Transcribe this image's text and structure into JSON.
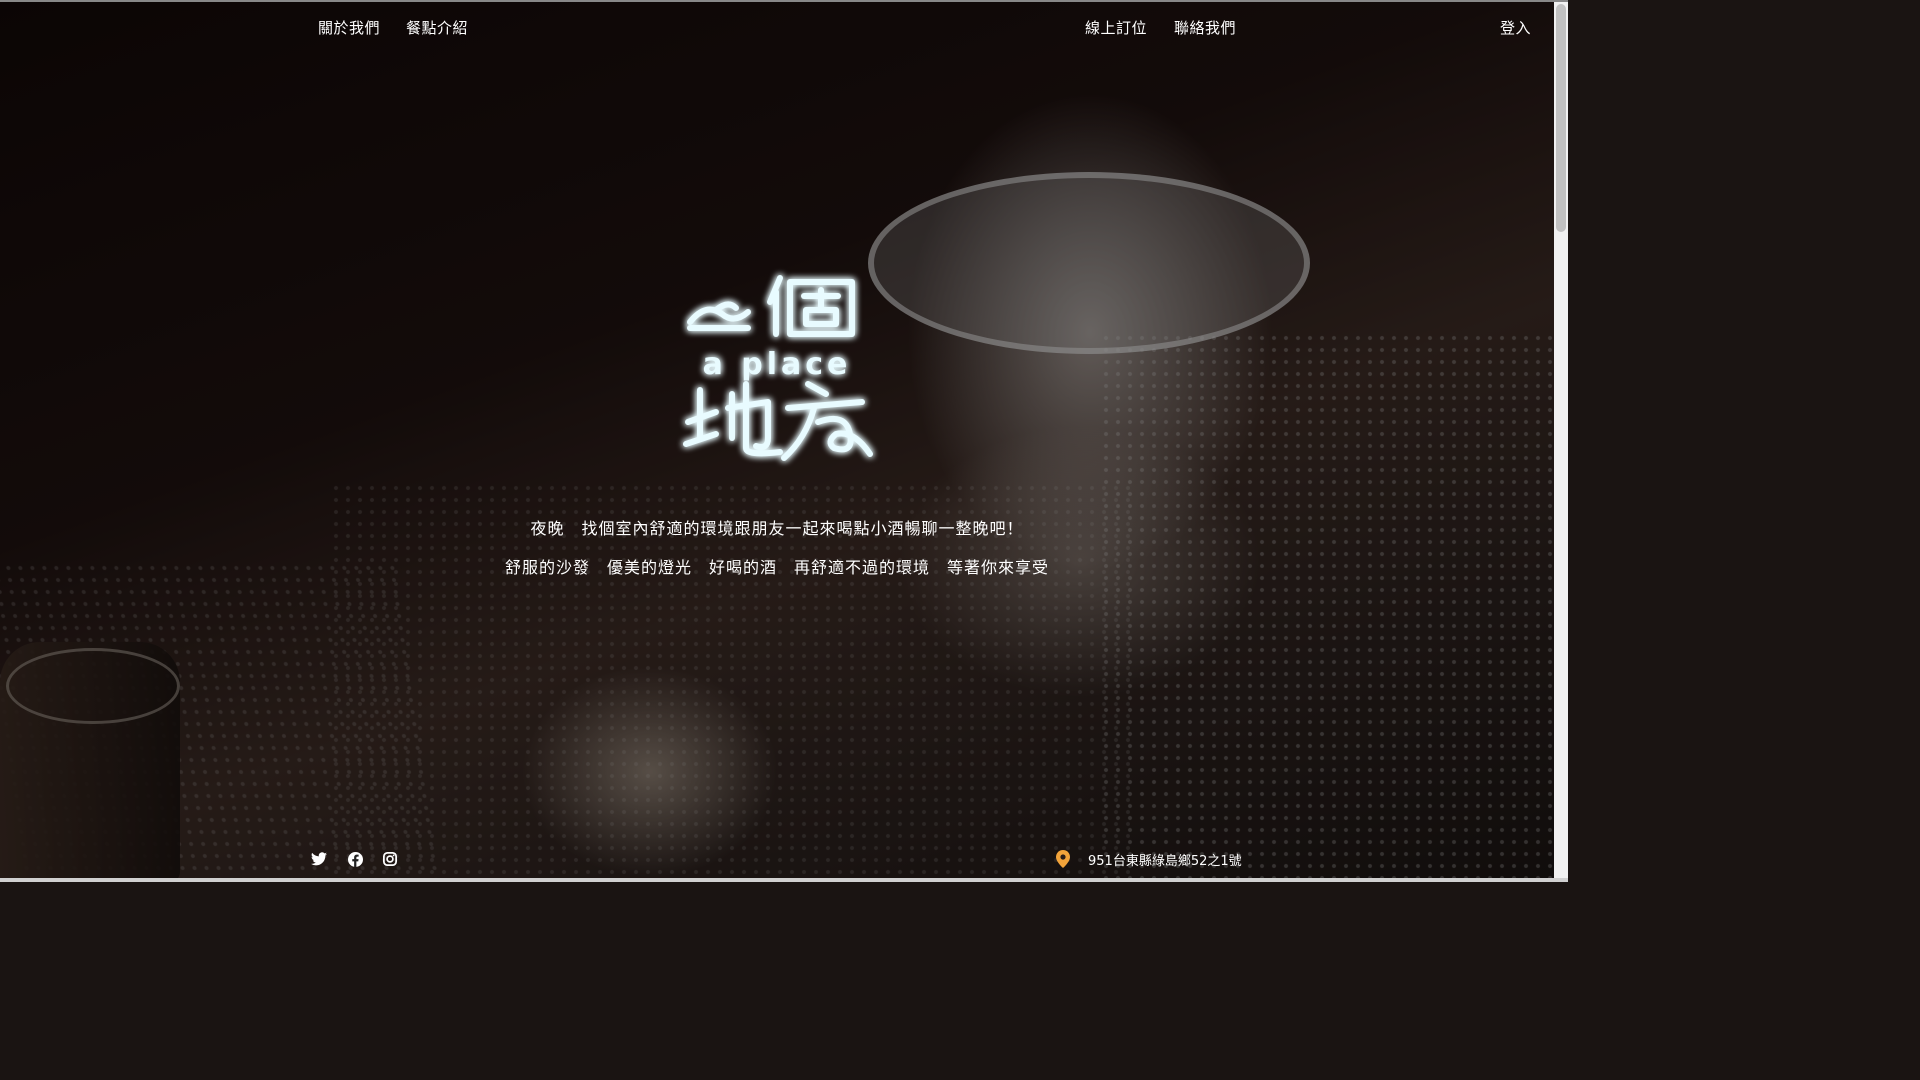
{
  "nav": {
    "left": [
      "關於我們",
      "餐點介紹"
    ],
    "right": [
      "線上訂位",
      "聯絡我們"
    ],
    "login": "登入"
  },
  "hero": {
    "logo_chinese": "一個地方",
    "logo_english": "a place",
    "tagline_line1": "夜晚　找個室內舒適的環境跟朋友一起來喝點小酒暢聊一整晚吧！",
    "tagline_line2": "舒服的沙發　優美的燈光　好喝的酒　再舒適不過的環境　等著你來享受"
  },
  "footer": {
    "social_icons": [
      "twitter-icon",
      "facebook-icon",
      "instagram-icon"
    ],
    "address": "951台東縣綠島鄉52之1號"
  },
  "colors": {
    "logo_glow": "#5fd6ff",
    "pin": "#f2a33a"
  }
}
